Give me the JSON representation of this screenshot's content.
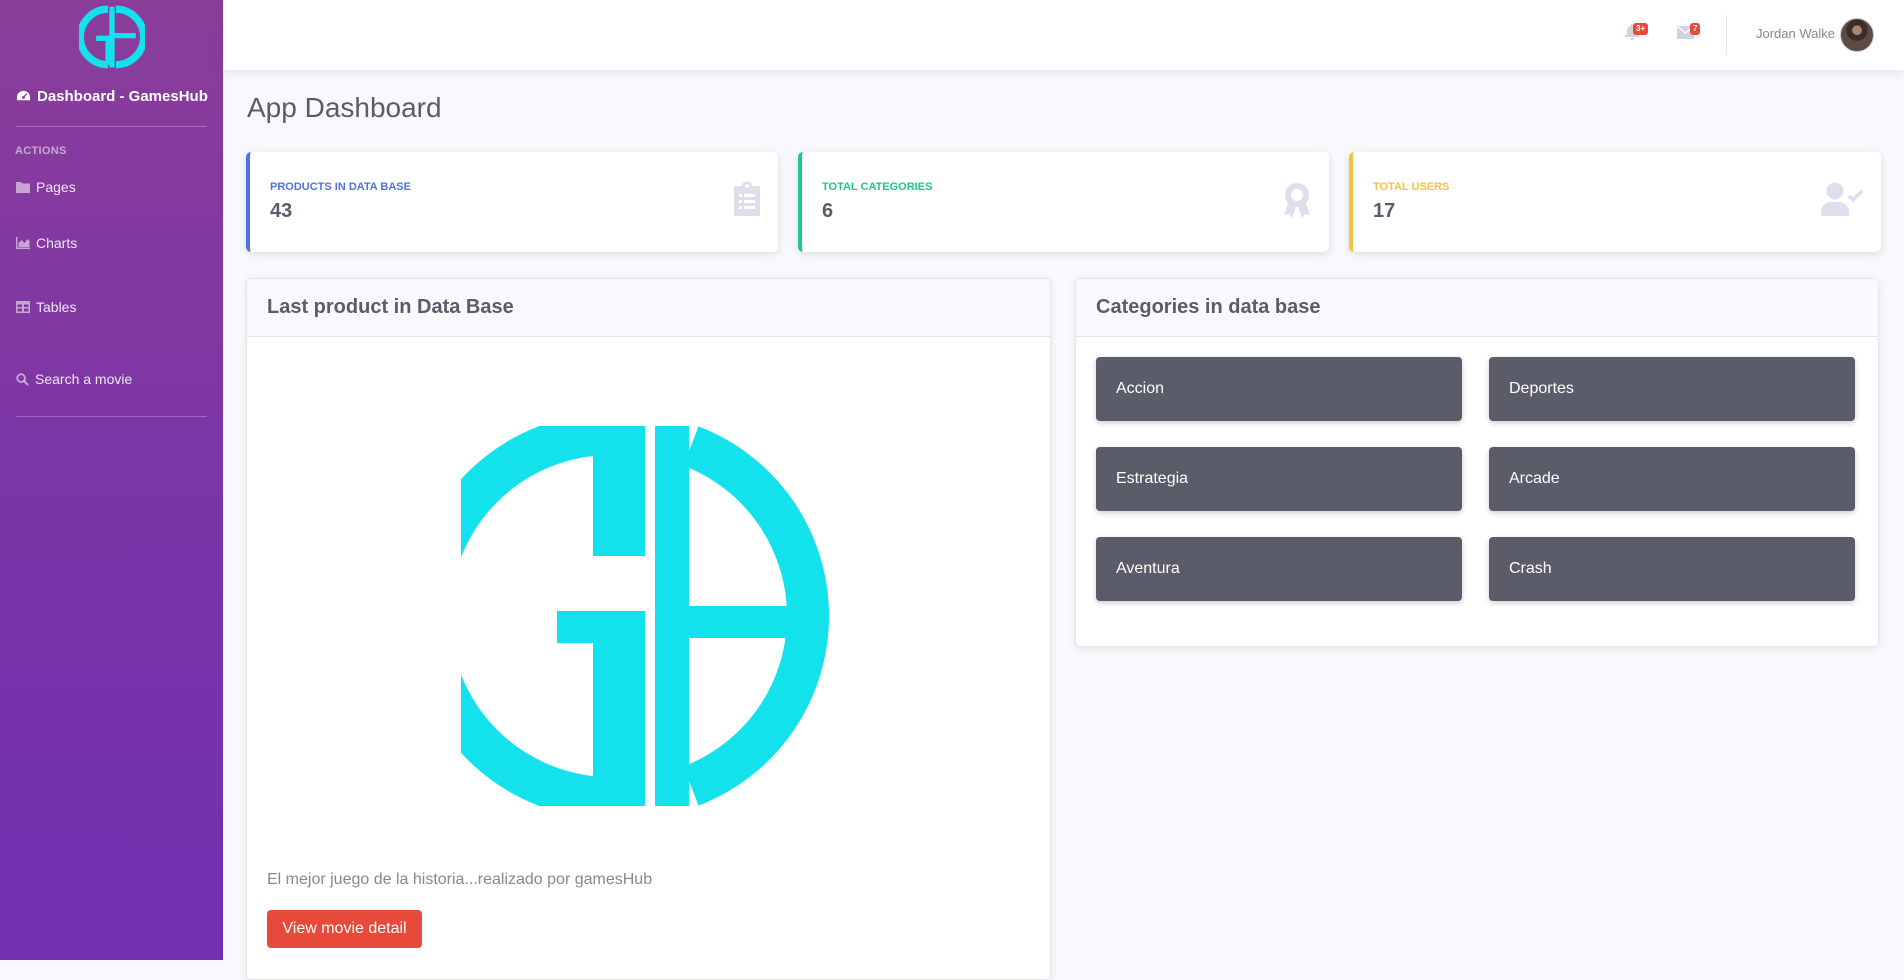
{
  "sidebar": {
    "brand": "Dashboard - GamesHub",
    "heading": "ACTIONS",
    "items": [
      {
        "label": "Pages",
        "icon": "folder-icon"
      },
      {
        "label": "Charts",
        "icon": "chart-area-icon"
      },
      {
        "label": "Tables",
        "icon": "table-icon"
      },
      {
        "label": "Search a movie",
        "icon": "search-icon"
      }
    ]
  },
  "topbar": {
    "alerts_badge": "3+",
    "messages_badge": "7",
    "user_name": "Jordan Walke"
  },
  "page": {
    "title": "App Dashboard"
  },
  "stats": [
    {
      "label": "Products in Data Base",
      "value": "43",
      "color": "#4e73df",
      "icon": "clipboard-list-icon"
    },
    {
      "label": "Total categories",
      "value": "6",
      "color": "#1cc88a",
      "icon": "award-icon"
    },
    {
      "label": "Total users",
      "value": "17",
      "color": "#f6c23e",
      "icon": "user-check-icon"
    }
  ],
  "last_product": {
    "title": "Last product in Data Base",
    "description": "El mejor juego de la historia...realizado por gamesHub",
    "button_label": "View movie detail"
  },
  "categories": {
    "title": "Categories in data base",
    "items": [
      "Accion",
      "Deportes",
      "Estrategia",
      "Arcade",
      "Aventura",
      "Crash"
    ]
  },
  "colors": {
    "logo_cyan": "#13e2ec",
    "danger": "#e74a3b",
    "tile": "#5a5c69"
  }
}
